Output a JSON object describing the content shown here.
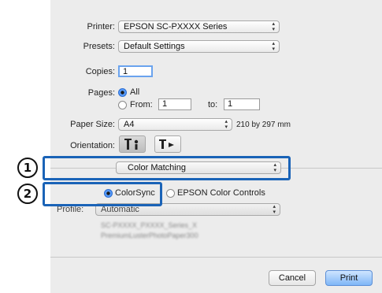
{
  "dialog": {
    "printer_label": "Printer:",
    "printer_value": "EPSON SC-PXXXX Series",
    "presets_label": "Presets:",
    "presets_value": "Default Settings",
    "copies_label": "Copies:",
    "copies_value": "1",
    "pages_label": "Pages:",
    "pages_all": "All",
    "pages_from": "From:",
    "pages_from_value": "1",
    "pages_to": "to:",
    "pages_to_value": "1",
    "paper_size_label": "Paper Size:",
    "paper_size_value": "A4",
    "paper_size_dims": "210 by 297 mm",
    "orientation_label": "Orientation:",
    "section_value": "Color Matching",
    "colorsync_label": "ColorSync",
    "epson_color_label": "EPSON Color Controls",
    "profile_label": "Profile:",
    "profile_value": "Automatic",
    "blur_line_1": "SC-PXXXX_PXXXX_Series_X",
    "blur_line_2": "PremiumLusterPhotoPaper300",
    "cancel_label": "Cancel",
    "print_label": "Print"
  },
  "callouts": {
    "one": "1",
    "two": "2"
  },
  "colors": {
    "callout_blue": "#1a63b7",
    "dialog_bg": "#ececec",
    "default_button": "#7fb6f7"
  }
}
